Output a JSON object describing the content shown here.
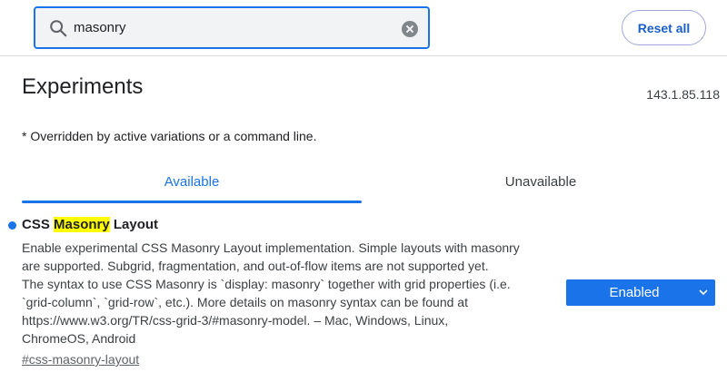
{
  "search": {
    "value": "masonry",
    "icon": "search-icon",
    "clear_icon": "clear-icon"
  },
  "toolbar": {
    "reset_label": "Reset all"
  },
  "page": {
    "title": "Experiments",
    "version": "143.1.85.118",
    "note": "* Overridden by active variations or a command line."
  },
  "tabs": [
    {
      "label": "Available",
      "selected": true
    },
    {
      "label": "Unavailable",
      "selected": false
    }
  ],
  "experiment": {
    "title_before": "CSS ",
    "title_highlight": "Masonry",
    "title_after": " Layout",
    "description_lines": [
      "Enable experimental CSS Masonry Layout implementation. Simple layouts with masonry",
      "are supported. Subgrid, fragmentation, and out-of-flow items are not supported yet.",
      "The syntax to use CSS Masonry is `display: masonry` together with grid properties (i.e.",
      "`grid-column`, `grid-row`, etc.). More details on masonry syntax can be found at",
      "https://www.w3.org/TR/css-grid-3/#masonry-model. – Mac, Windows, Linux,",
      "ChromeOS, Android"
    ],
    "link": "#css-masonry-layout",
    "state": "Enabled"
  },
  "colors": {
    "accent": "#1a73e8",
    "highlight": "#ffff00"
  }
}
